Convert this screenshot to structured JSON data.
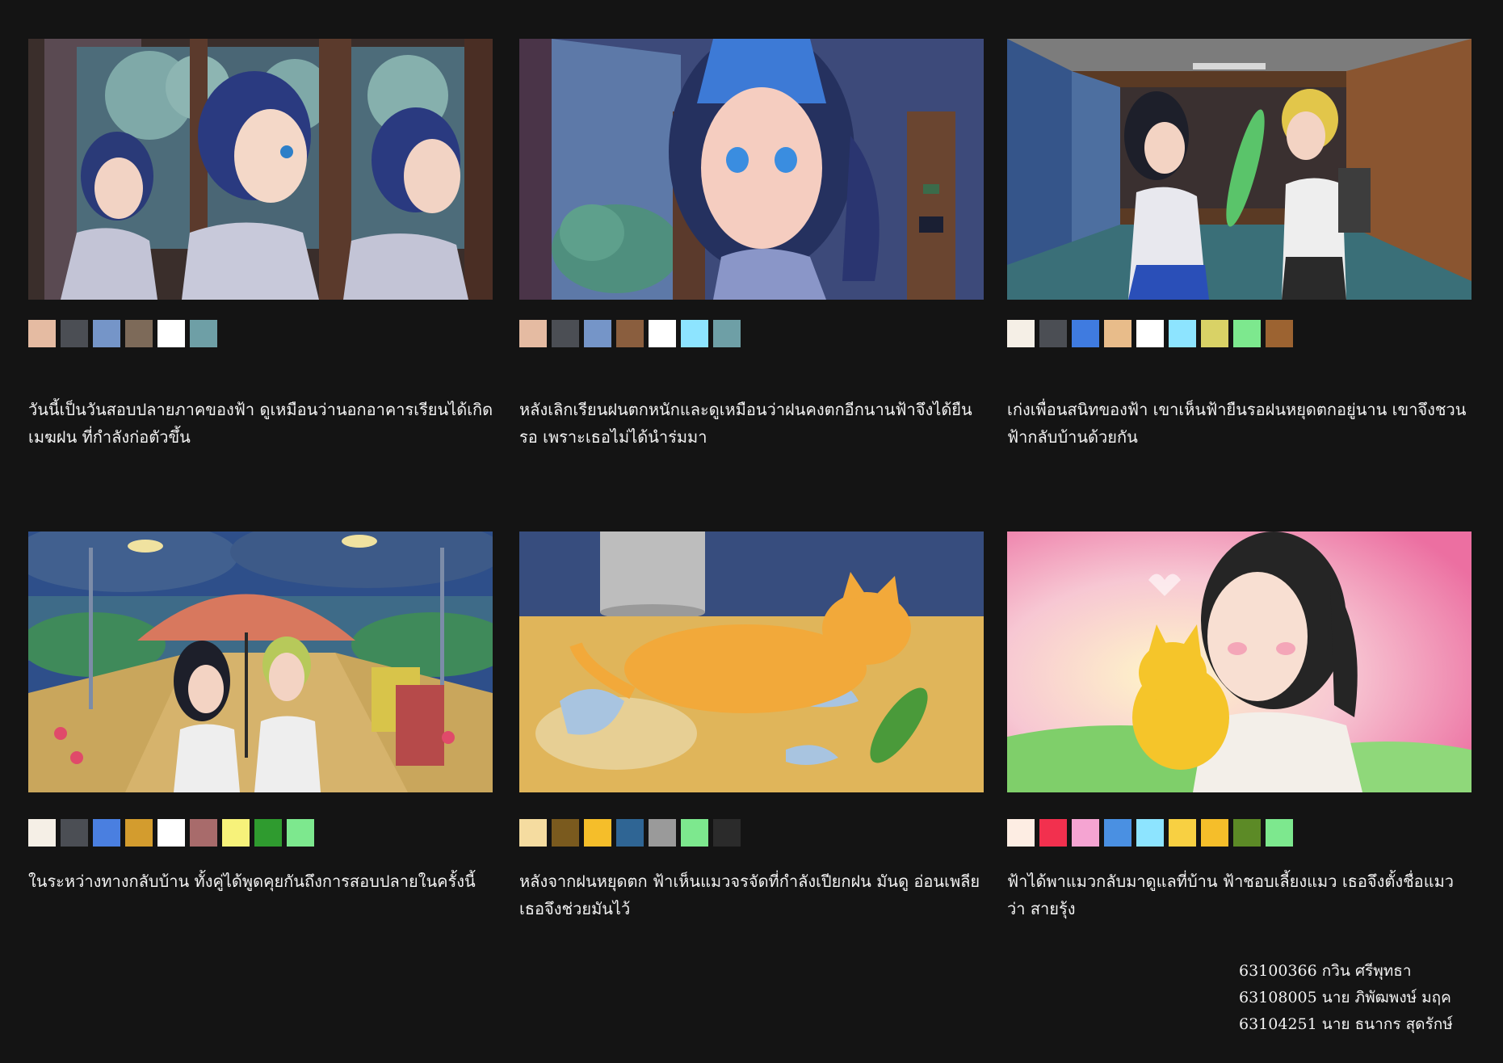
{
  "panels": [
    {
      "scene": "school-corridor-window-scene",
      "swatches": [
        "#E5BBA2",
        "#4B4E54",
        "#7595C8",
        "#7D6A59",
        "#FFFFFF",
        "#6E9FA6"
      ],
      "caption": "วันนี้เป็นวันสอบปลายภาคของฟ้า ดูเหมือนว่านอกอาคารเรียนได้เกิด เมฆฝน ที่กำลังก่อตัวขึ้น"
    },
    {
      "scene": "girl-closeup-rain-scene",
      "swatches": [
        "#E5BBA2",
        "#4B4E54",
        "#7595C8",
        "#8A5E3E",
        "#FFFFFF",
        "#8DE4FF",
        "#6E9FA6"
      ],
      "caption": "หลังเลิกเรียนฝนตกหนักและดูเหมือนว่าฝนคงตกอีกนานฟ้าจึงได้ยืน รอ เพราะเธอไม่ได้นำร่มมา"
    },
    {
      "scene": "friend-offers-umbrella-scene",
      "swatches": [
        "#F5EFE6",
        "#4B4E54",
        "#3F7BE0",
        "#E8BC8A",
        "#FFFFFF",
        "#8DE4FF",
        "#D9D266",
        "#7DE88E",
        "#9C6331"
      ],
      "caption": "เก่งเพื่อนสนิทของฟ้า เขาเห็นฟ้ายืนรอฝนหยุดตกอยู่นาน เขาจึงชวน ฟ้ากลับบ้านด้วยกัน"
    },
    {
      "scene": "walking-home-umbrella-scene",
      "swatches": [
        "#F5EFE6",
        "#4B4E54",
        "#4A7FE0",
        "#D39C2E",
        "#FFFFFF",
        "#A86B6B",
        "#F7F27A",
        "#2F9B2F",
        "#7DE88E"
      ],
      "caption": "ในระหว่างทางกลับบ้าน ทั้งคู่ได้พูดคุยกันถึงการสอบปลายในครั้งนี้"
    },
    {
      "scene": "wet-stray-cat-scene",
      "swatches": [
        "#F5DCA0",
        "#7A5A1E",
        "#F5BE2A",
        "#2F6594",
        "#9A9A9A",
        "#7DE88E",
        "#2B2B2B"
      ],
      "caption": "หลังจากฝนหยุดตก ฟ้าเห็นแมวจรจัดที่กำลังเปียกฝน มันดู อ่อนเพลีย เธอจึงช่วยมันไว้"
    },
    {
      "scene": "girl-hugging-cat-scene",
      "swatches": [
        "#FDEDE3",
        "#F2304E",
        "#F5A4D2",
        "#4A90E2",
        "#8DE4FF",
        "#F8D042",
        "#F5BE2A",
        "#5C8A26",
        "#7DE88E"
      ],
      "caption": "ฟ้าได้พาแมวกลับมาดูแลที่บ้าน ฟ้าชอบเลี้ยงแมว เธอจึงตั้งชื่อแมว ว่า สายรุ้ง"
    }
  ],
  "credits": [
    "63100366 กวิน ศรีพุทธา",
    "63108005 นาย ภิพัฒพงษ์ มฤค",
    "63104251 นาย ธนากร สุดรักษ์"
  ]
}
